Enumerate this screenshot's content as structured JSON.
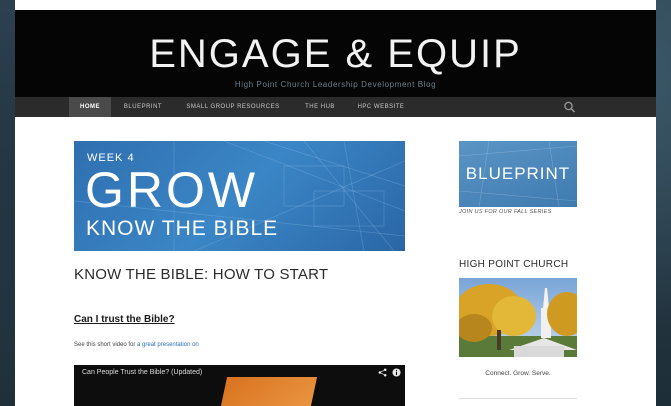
{
  "site": {
    "title": "ENGAGE & EQUIP",
    "description": "High Point Church Leadership Development Blog"
  },
  "nav": {
    "items": [
      {
        "label": "HOME",
        "active": true
      },
      {
        "label": "BLUEPRINT"
      },
      {
        "label": "SMALL GROUP RESOURCES"
      },
      {
        "label": "THE HUB"
      },
      {
        "label": "HPC WEBSITE"
      }
    ],
    "search_icon": "search-icon"
  },
  "post": {
    "hero": {
      "week": "WEEK 4",
      "headline": "GROW",
      "subline": "KNOW THE BIBLE"
    },
    "title": "KNOW THE BIBLE: HOW TO START",
    "subheading": "Can I trust the Bible?",
    "body_prefix": "See this short video for ",
    "body_link": "a great presentation on",
    "video": {
      "title": "Can People Trust the Bible? (Updated)"
    }
  },
  "sidebar": {
    "banner_text": "BLUEPRINT",
    "banner_caption": "JOIN US FOR OUR FALL SERIES",
    "widget_title": "HIGH POINT CHURCH",
    "photo_caption": "Connect. Grow. Serve."
  },
  "colors": {
    "header_bg": "#050505",
    "nav_bg": "#2b2b2b",
    "hero_blue": "#3b86c6",
    "link_blue": "#2a70b8"
  }
}
